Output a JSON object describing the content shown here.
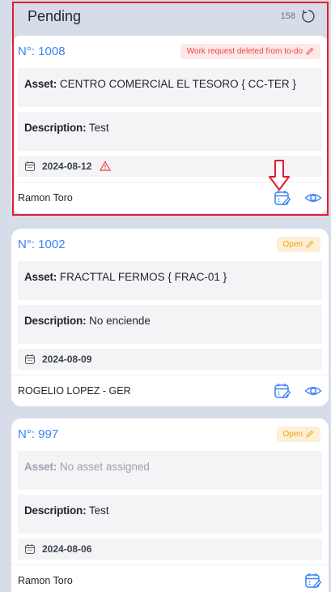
{
  "header": {
    "title": "Pending",
    "count": "158"
  },
  "cards": [
    {
      "number": "N°: 1008",
      "badge": "Work request deleted from to-do",
      "badge_type": "deleted",
      "asset_label": "Asset:",
      "asset_value": "CENTRO COMERCIAL EL TESORO  { CC-TER }",
      "description_label": "Description:",
      "description_value": "Test",
      "date": "2024-08-12",
      "assignee": "Ramon Toro"
    },
    {
      "number": "N°: 1002",
      "badge": "Open",
      "badge_type": "open",
      "asset_label": "Asset:",
      "asset_value": "FRACTTAL FERMOS  { FRAC-01 }",
      "description_label": "Description:",
      "description_value": "No enciende",
      "date": "2024-08-09",
      "assignee": "ROGELIO LOPEZ - GER"
    },
    {
      "number": "N°: 997",
      "badge": "Open",
      "badge_type": "open",
      "asset_label": "Asset:",
      "asset_value": "No asset assigned",
      "description_label": "Description:",
      "description_value": "Test",
      "date": "2024-08-06",
      "assignee": "Ramon Toro"
    }
  ],
  "colors": {
    "accent": "#3b82f6",
    "annotation": "#e11d2e",
    "open_badge": "#f59e0b",
    "deleted_badge": "#ef4444"
  }
}
